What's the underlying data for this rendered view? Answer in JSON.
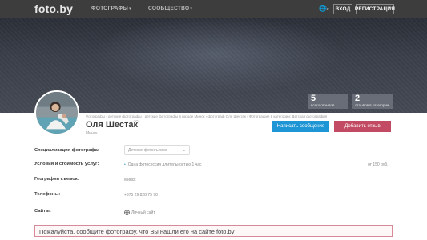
{
  "nav": {
    "logo": "foto.by",
    "items": [
      {
        "label": "ФОТОГРАФЫ"
      },
      {
        "label": "СООБЩЕСТВО"
      }
    ],
    "login": "ВХОД",
    "register": "РЕГИСТРАЦИЯ"
  },
  "stats": [
    {
      "value": "5",
      "label": "всего отзывов"
    },
    {
      "value": "2",
      "label": "отзывов в категории"
    }
  ],
  "profile": {
    "breadcrumb": "Фотографы › детские фотографы › детские фотографы в городе Минск › фотограф Оля Шестак › Фотография в категории: Детская фотография",
    "name": "Оля Шестак",
    "city": "Минск",
    "message_button": "Написать сообщение",
    "review_button": "Добавить отзыв"
  },
  "info": {
    "specialization_label": "Специализация фотографа:",
    "specialization_value": "Детская фотосъемка",
    "conditions_label": "Условия и стоимость услуг:",
    "conditions_value": "Одна фотосессия длительностью 1 час",
    "conditions_price": "от 150 руб.",
    "geography_label": "География съемок:",
    "geography_value": "Минск",
    "phones_label": "Телефоны:",
    "phones_value": "+375 29 828 75 78",
    "sites_label": "Сайты:",
    "sites_value": "Личный сайт"
  },
  "notice": "Пожалуйста, сообщите фотографу, что Вы нашли его на сайте foto.by"
}
